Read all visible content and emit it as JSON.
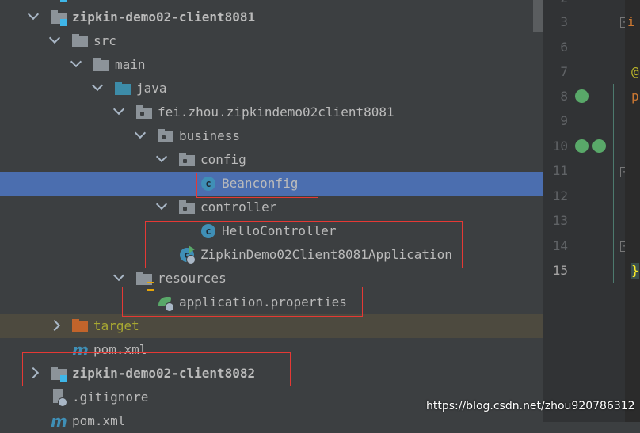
{
  "tree": [
    {
      "label": "",
      "depth": 1,
      "kind": "module",
      "chevron": "none",
      "partial": true
    },
    {
      "label": "zipkin-demo02-client8081",
      "depth": 1,
      "kind": "module",
      "chevron": "down",
      "bold": true
    },
    {
      "label": "src",
      "depth": 2,
      "kind": "folder",
      "chevron": "down"
    },
    {
      "label": "main",
      "depth": 3,
      "kind": "folder",
      "chevron": "down"
    },
    {
      "label": "java",
      "depth": 4,
      "kind": "java",
      "chevron": "down"
    },
    {
      "label": "fei.zhou.zipkindemo02client8081",
      "depth": 5,
      "kind": "package",
      "chevron": "down"
    },
    {
      "label": "business",
      "depth": 6,
      "kind": "package",
      "chevron": "down"
    },
    {
      "label": "config",
      "depth": 7,
      "kind": "package",
      "chevron": "down"
    },
    {
      "label": "Beanconfig",
      "depth": 8,
      "kind": "class",
      "chevron": "none",
      "selected": true
    },
    {
      "label": "controller",
      "depth": 7,
      "kind": "package",
      "chevron": "down"
    },
    {
      "label": "HelloController",
      "depth": 8,
      "kind": "class",
      "chevron": "none"
    },
    {
      "label": "ZipkinDemo02Client8081Application",
      "depth": 7,
      "kind": "springapp",
      "chevron": "none"
    },
    {
      "label": "resources",
      "depth": 5,
      "kind": "resources",
      "chevron": "down"
    },
    {
      "label": "application.properties",
      "depth": 6,
      "kind": "springprops",
      "chevron": "none"
    },
    {
      "label": "target",
      "depth": 2,
      "kind": "target",
      "chevron": "right",
      "excluded": true
    },
    {
      "label": "pom.xml",
      "depth": 2,
      "kind": "maven",
      "chevron": "none"
    },
    {
      "label": "zipkin-demo02-client8082",
      "depth": 1,
      "kind": "module",
      "chevron": "right",
      "bold": true
    },
    {
      "label": ".gitignore",
      "depth": 1,
      "kind": "ignore",
      "chevron": "none"
    },
    {
      "label": "pom.xml",
      "depth": 1,
      "kind": "maven",
      "chevron": "none"
    }
  ],
  "gutter": {
    "line_numbers": [
      "2",
      "3",
      "6",
      "7",
      "8",
      "9",
      "10",
      "11",
      "12",
      "13",
      "14",
      "15"
    ],
    "current_line": "15"
  },
  "code_fragments": {
    "line3": "i",
    "line7": "@",
    "line8": "p",
    "line15": "}"
  },
  "watermark": "https://blog.csdn.net/zhou920786312",
  "colors": {
    "selection": "#4b6eaf",
    "highlight_box": "#e53935",
    "accent": "#3fb6e8"
  }
}
